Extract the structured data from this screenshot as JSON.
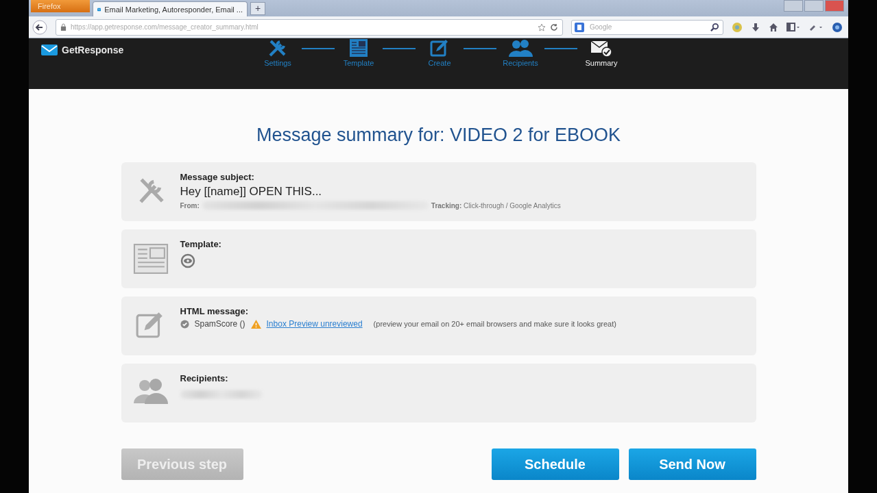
{
  "browser": {
    "menu_button": "Firefox",
    "tab_title": "Email Marketing, Autoresponder, Email ...",
    "new_tab": "+",
    "url": "https://app.getresponse.com/message_creator_summary.html",
    "search_placeholder": "Google"
  },
  "app": {
    "logo": "GetResponse",
    "steps": [
      {
        "label": "Settings",
        "kind": "settings",
        "selected": false
      },
      {
        "label": "Template",
        "kind": "template",
        "selected": false
      },
      {
        "label": "Create",
        "kind": "create",
        "selected": false
      },
      {
        "label": "Recipients",
        "kind": "recipients",
        "selected": false
      },
      {
        "label": "Summary",
        "kind": "summary",
        "selected": true
      }
    ],
    "title": "Message summary for: VIDEO 2 for EBOOK",
    "sections": [
      {
        "kind": "subject",
        "label": "Message subject:",
        "value": "Hey [[name]] OPEN THIS...",
        "from_label": "From:",
        "tracking": "**Tracking:** Click-through / Google Analytics"
      },
      {
        "kind": "template",
        "label": "Template:"
      },
      {
        "kind": "html",
        "label": "HTML message:",
        "spam_score": "SpamScore ()",
        "link": "Inbox Preview unreviewed",
        "note": "(preview your email on 20+ email browsers and make sure it looks great)"
      },
      {
        "kind": "recipients",
        "label": "Recipients:"
      }
    ],
    "buttons": [
      {
        "label": "Previous step",
        "disabled": true
      },
      {
        "label": "Schedule",
        "disabled": false
      },
      {
        "label": "Send Now",
        "disabled": false
      }
    ]
  }
}
